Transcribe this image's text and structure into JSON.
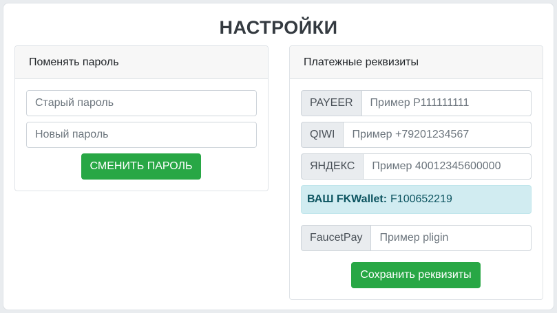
{
  "page": {
    "title": "НАСТРОЙКИ"
  },
  "password_card": {
    "header": "Поменять пароль",
    "old_password_placeholder": "Старый пароль",
    "new_password_placeholder": "Новый пароль",
    "submit_label": "СМЕНИТЬ ПАРОЛЬ"
  },
  "payment_card": {
    "header": "Платежные реквизиты",
    "fields": [
      {
        "label": "PAYEER",
        "placeholder": "Пример P111111111"
      },
      {
        "label": "QIWI",
        "placeholder": "Пример +79201234567"
      },
      {
        "label": "ЯНДЕКС",
        "placeholder": "Пример 40012345600000"
      },
      {
        "label": "FaucetPay",
        "placeholder": "Пример pligin"
      }
    ],
    "fkwallet_label": "ВАШ FKWallet:",
    "fkwallet_value": "F100652219",
    "submit_label": "Сохранить реквизиты"
  },
  "colors": {
    "button": "#28a745",
    "alert_bg": "#d1ecf1",
    "alert_text": "#0c5460"
  }
}
